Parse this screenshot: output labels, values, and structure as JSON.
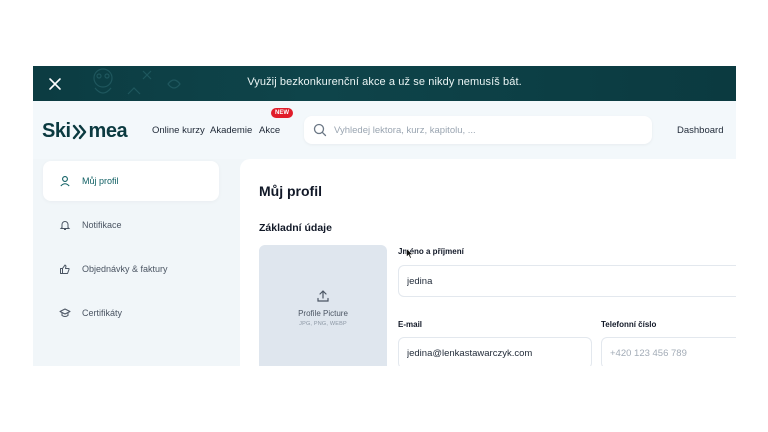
{
  "banner": {
    "text": "Využij bezkonkurenční akce a už se nikdy nemusíš bát."
  },
  "header": {
    "logo_left": "Ski",
    "logo_right": "mea",
    "nav": [
      "Online kurzy",
      "Akademie",
      "Akce"
    ],
    "new_badge": "NEW",
    "search_placeholder": "Vyhledej lektora, kurz, kapitolu, ...",
    "dashboard": "Dashboard"
  },
  "sidebar": {
    "items": [
      {
        "label": "Můj profil",
        "icon": "user-icon",
        "active": true
      },
      {
        "label": "Notifikace",
        "icon": "bell-icon",
        "active": false
      },
      {
        "label": "Objednávky & faktury",
        "icon": "thumbs-up-icon",
        "active": false
      },
      {
        "label": "Certifikáty",
        "icon": "graduation-cap-icon",
        "active": false
      }
    ]
  },
  "main": {
    "title": "Můj profil",
    "section": "Základní údaje",
    "profile_picture": {
      "label": "Profile Picture",
      "hint": "JPG, PNG, WEBP"
    },
    "fields": {
      "name_label": "Jméno a příjmení",
      "name_value": "jedina",
      "email_label": "E-mail",
      "email_value": "jedina@lenkastawarczyk.com",
      "phone_label": "Telefonní číslo",
      "phone_placeholder": "+420 123 456 789"
    }
  },
  "colors": {
    "banner_bg": "#0c3c42",
    "brand": "#0b3a40",
    "accent": "#0f5f63",
    "badge": "#e11d2a"
  }
}
